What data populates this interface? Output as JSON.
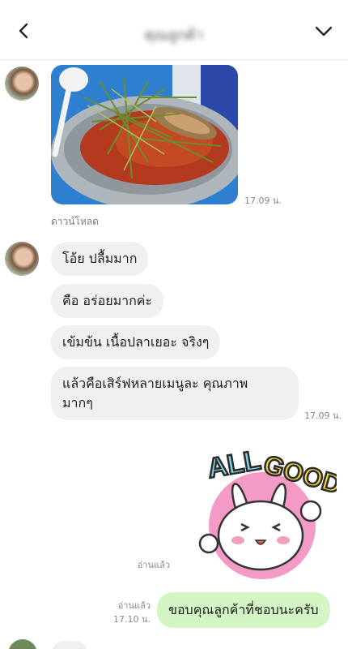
{
  "header": {
    "title": "คุณลูกค้า",
    "back_icon": "chevron-left-icon",
    "menu_icon": "chevron-down-icon"
  },
  "messages": {
    "photo": {
      "time": "17.09 น.",
      "download_label": "ดาวน์โหลด"
    },
    "incoming": [
      "โอ้ย ปลื้มมาก",
      "คือ อร่อยมากค่ะ",
      "เข้มข้น เนื้อปลาเยอะ จริงๆ",
      "แล้วคือเสิร์ฟหลายเมนูละ คุณภาพ\nมากๆ"
    ],
    "incoming_time": "17.09 น.",
    "sticker": {
      "text": "ALL GOOD!",
      "read_label": "อ่านแล้ว"
    },
    "outgoing": {
      "text": "ขอบคุณลูกค้าที่ชอบนะครับ",
      "read_label": "อ่านแล้ว",
      "time": "17.10 น."
    }
  },
  "colors": {
    "incoming_bubble": "#f0f0f0",
    "outgoing_bubble": "#d4f5c4",
    "meta_text": "#8a8a8a"
  }
}
